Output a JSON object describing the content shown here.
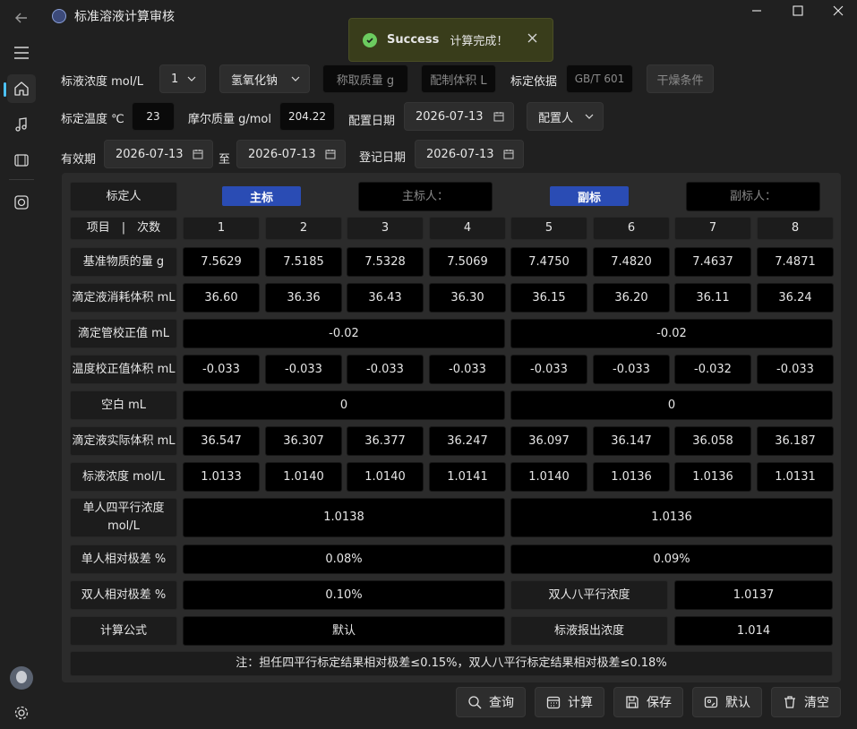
{
  "app": {
    "title": "标准溶液计算审核"
  },
  "toast": {
    "title": "Success",
    "message": "计算完成！"
  },
  "nav": {
    "icons": [
      "back-icon",
      "menu-icon",
      "home-icon",
      "music-icon",
      "film-icon",
      "camera-icon",
      "avatar",
      "gear-icon"
    ]
  },
  "form": {
    "concentration_label": "标液浓度 mol/L",
    "concentration_value": "1",
    "substance_value": "氢氧化钠",
    "weigh_mass_placeholder": "称取质量 g",
    "prep_volume_placeholder": "配制体积 L",
    "basis_label": "标定依据",
    "basis_placeholder": "GB/T 601",
    "dry_condition_placeholder": "干燥条件",
    "temp_label": "标定温度 ℃",
    "temp_value": "23",
    "molar_label": "摩尔质量 g/mol",
    "molar_value": "204.22",
    "prep_date_label": "配置日期",
    "prep_date_value": "2026-07-13",
    "preparer_value": "配置人",
    "valid_label": "有效期",
    "valid_from": "2026-07-13",
    "to_label": "至",
    "valid_to": "2026-07-13",
    "reg_date_label": "登记日期",
    "reg_date_value": "2026-07-13"
  },
  "table": {
    "calibrator_label": "标定人",
    "main_tag": "主标",
    "main_person_placeholder": "主标人：",
    "sub_tag": "副标",
    "sub_person_placeholder": "副标人：",
    "header_label": "项目　|　次数",
    "columns": [
      "1",
      "2",
      "3",
      "4",
      "5",
      "6",
      "7",
      "8"
    ],
    "rows": {
      "mass": {
        "label": "基准物质的量 g",
        "values": [
          "7.5629",
          "7.5185",
          "7.5328",
          "7.5069",
          "7.4750",
          "7.4820",
          "7.4637",
          "7.4871"
        ]
      },
      "titrant_volume": {
        "label": "滴定液消耗体积 mL",
        "values": [
          "36.60",
          "36.36",
          "36.43",
          "36.30",
          "36.15",
          "36.20",
          "36.11",
          "36.24"
        ]
      },
      "burette_correction": {
        "label": "滴定管校正值 mL",
        "main": "-0.02",
        "sub": "-0.02"
      },
      "temp_correction": {
        "label": "温度校正值体积 mL",
        "values": [
          "-0.033",
          "-0.033",
          "-0.033",
          "-0.033",
          "-0.033",
          "-0.033",
          "-0.032",
          "-0.033"
        ]
      },
      "blank": {
        "label": "空白 mL",
        "main": "0",
        "sub": "0"
      },
      "actual_volume": {
        "label": "滴定液实际体积 mL",
        "values": [
          "36.547",
          "36.307",
          "36.377",
          "36.247",
          "36.097",
          "36.147",
          "36.058",
          "36.187"
        ]
      },
      "concentration": {
        "label": "标液浓度 mol/L",
        "values": [
          "1.0133",
          "1.0140",
          "1.0140",
          "1.0141",
          "1.0140",
          "1.0136",
          "1.0136",
          "1.0131"
        ]
      },
      "single_avg": {
        "label": "单人四平行浓度 mol/L",
        "main": "1.0138",
        "sub": "1.0136"
      },
      "single_dev": {
        "label": "单人相对极差 %",
        "main": "0.08%",
        "sub": "0.09%"
      },
      "double_dev": {
        "label": "双人相对极差 %",
        "main": "0.10%",
        "extra_label": "双人八平行浓度",
        "extra_value": "1.0137"
      },
      "formula": {
        "label": "计算公式",
        "main": "默认",
        "extra_label": "标液报出浓度",
        "extra_value": "1.014"
      }
    },
    "note": "注：担任四平行标定结果相对极差≤0.15%，双人八平行标定结果相对极差≤0.18%"
  },
  "buttons": {
    "query": "查询",
    "calculate": "计算",
    "save": "保存",
    "default": "默认",
    "clear": "清空"
  }
}
